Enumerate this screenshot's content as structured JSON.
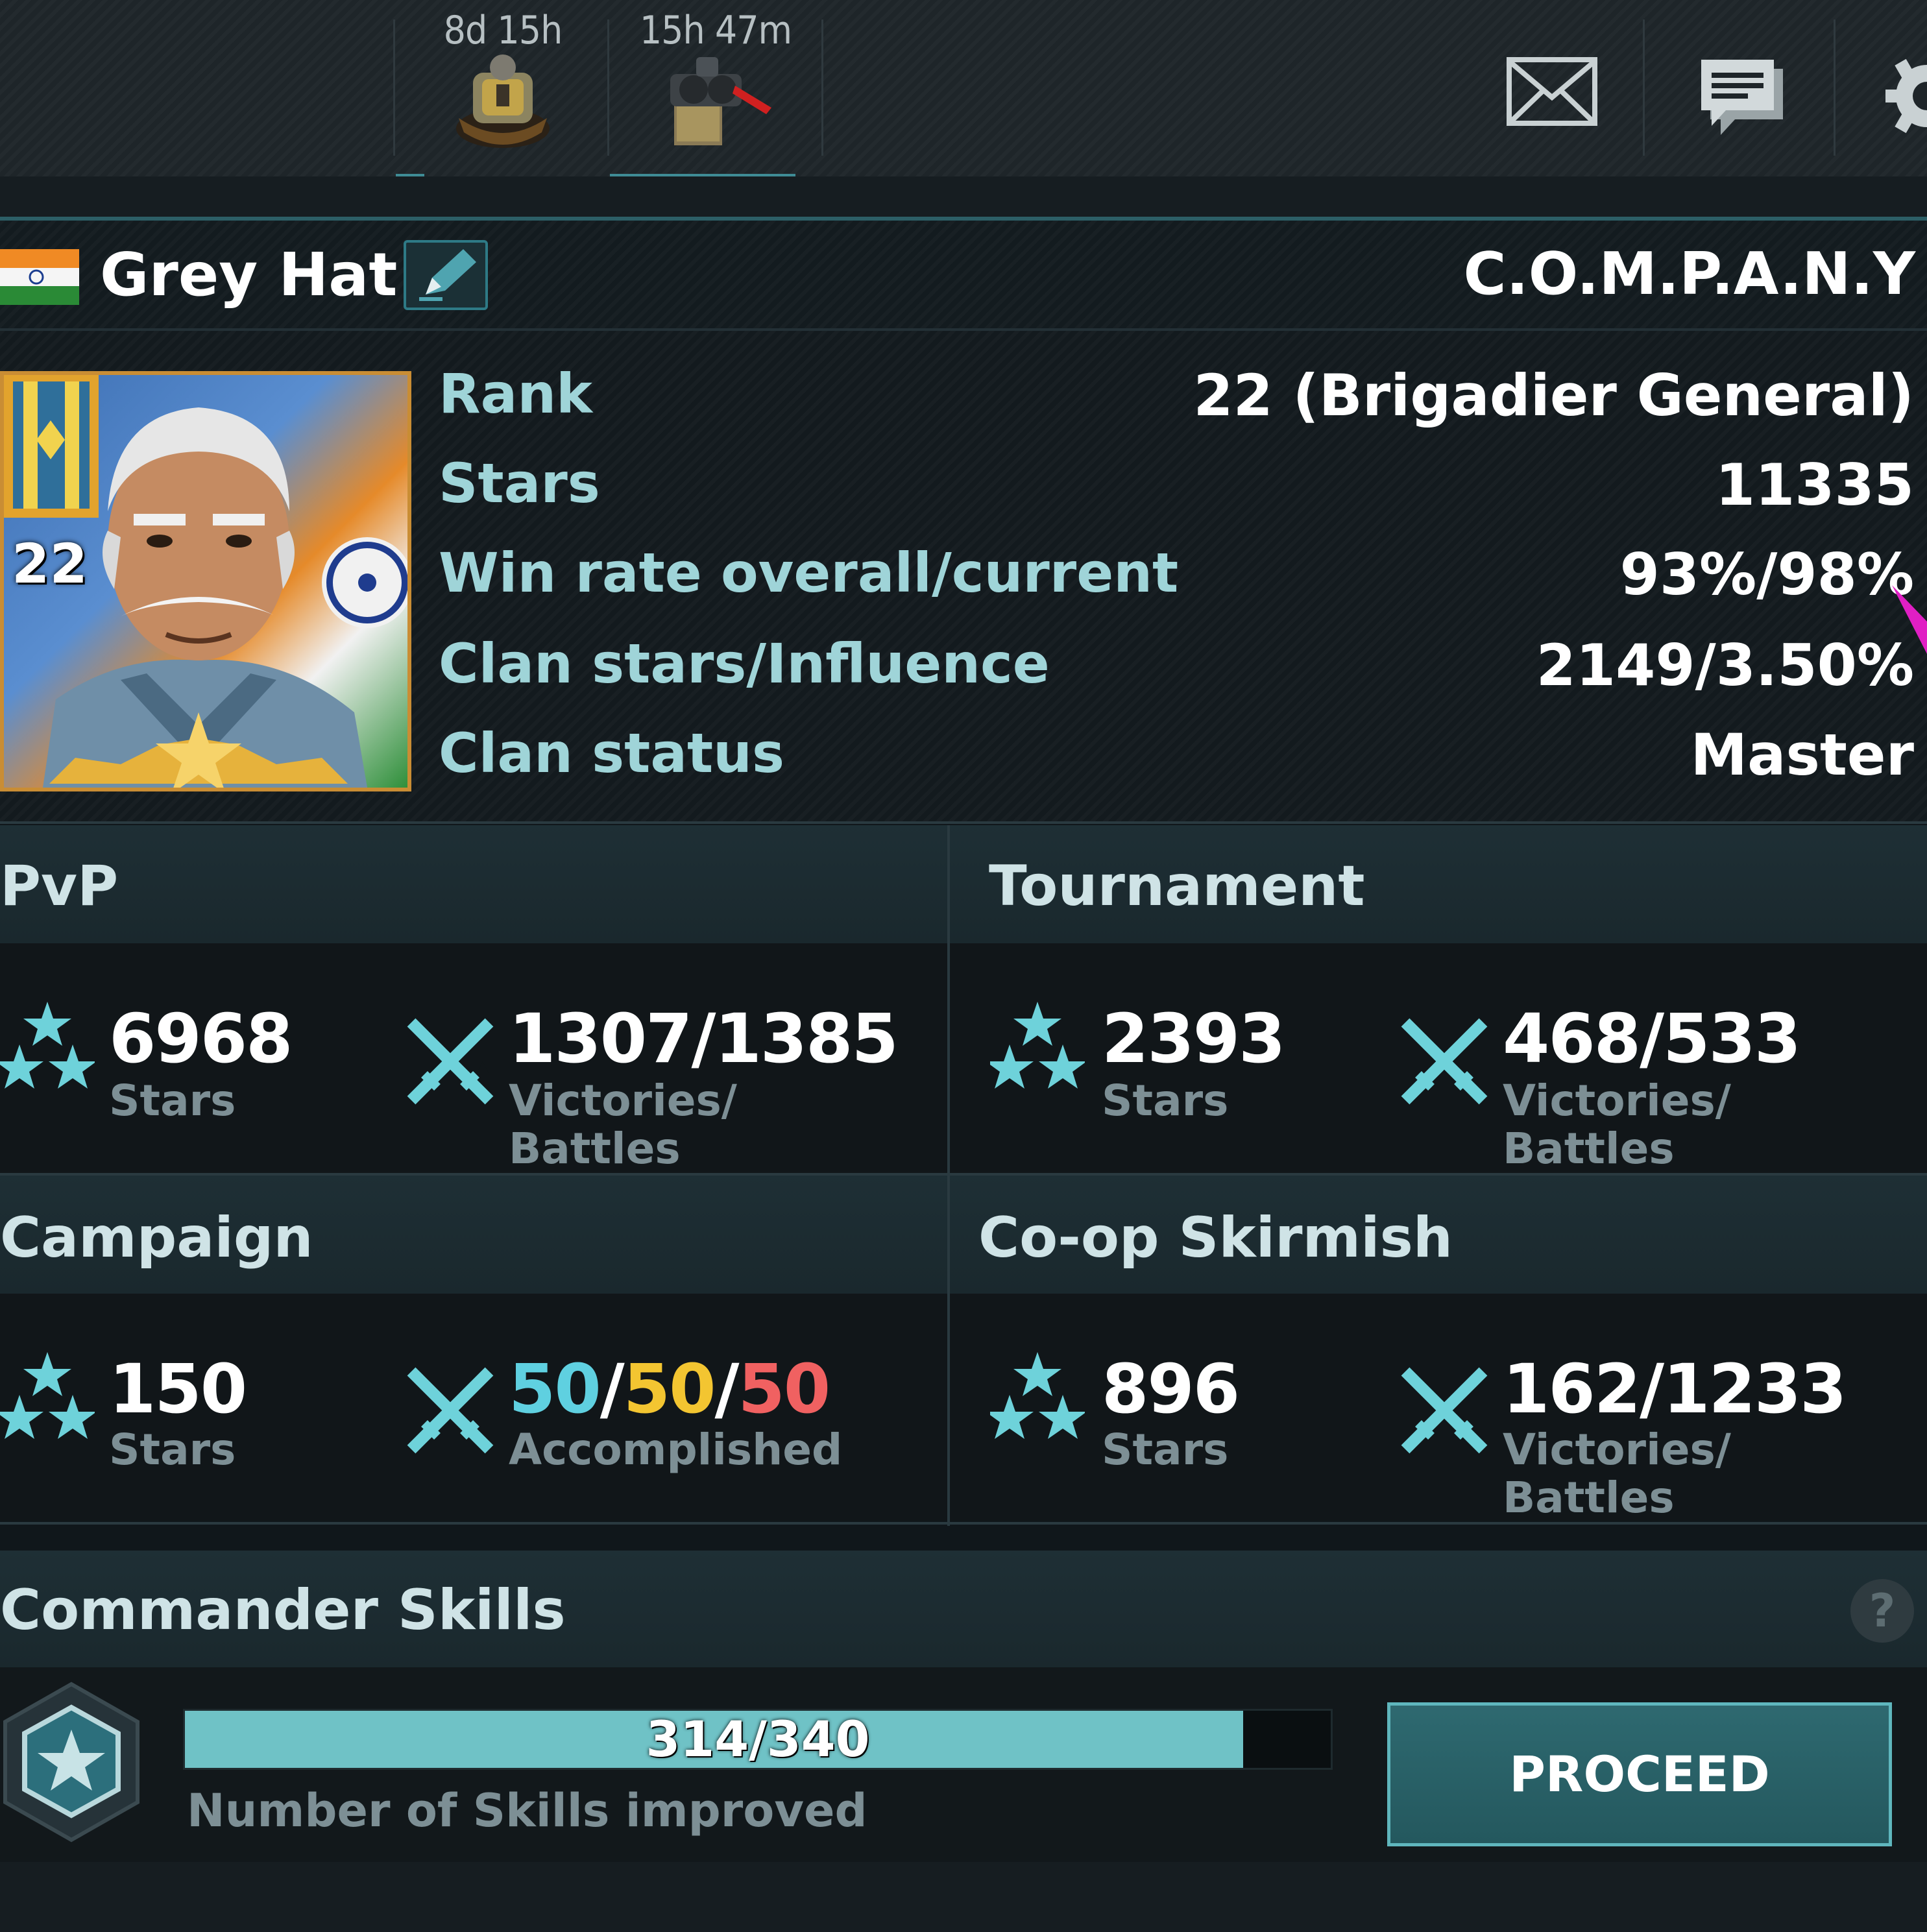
{
  "topbar": {
    "timers": [
      {
        "text": "8d 15h",
        "icon": "helmet-crate-icon"
      },
      {
        "text": "15h 47m",
        "icon": "weapon-crate-icon"
      }
    ],
    "icons": [
      "mail-icon",
      "chat-icon",
      "gear-icon"
    ]
  },
  "player": {
    "name": "Grey Hat",
    "flag": "india-flag-icon",
    "clan": "C.O.M.P.A.N.Y",
    "rank_badge": "22"
  },
  "stats": [
    {
      "label": "Rank",
      "value": "22 (Brigadier General)"
    },
    {
      "label": "Stars",
      "value": "11335"
    },
    {
      "label": "Win rate overall/current",
      "value": "93%/98%"
    },
    {
      "label": "Clan stars/Influence",
      "value": "2149/3.50%"
    },
    {
      "label": "Clan status",
      "value": "Master"
    }
  ],
  "modes": {
    "pvp": {
      "title": "PvP",
      "stars": "6968",
      "stars_label": "Stars",
      "record": "1307/1385",
      "record_label_1": "Victories/",
      "record_label_2": "Battles"
    },
    "tournament": {
      "title": "Tournament",
      "stars": "2393",
      "stars_label": "Stars",
      "record": "468/533",
      "record_label_1": "Victories/",
      "record_label_2": "Battles"
    },
    "campaign": {
      "title": "Campaign",
      "stars": "150",
      "stars_label": "Stars",
      "acc_1": "50",
      "acc_2": "50",
      "acc_3": "50",
      "sep": "/",
      "record_label_1": "Accomplished"
    },
    "coop": {
      "title": "Co-op Skirmish",
      "stars": "896",
      "stars_label": "Stars",
      "record": "162/1233",
      "record_label_1": "Victories/",
      "record_label_2": "Battles"
    }
  },
  "skills": {
    "title": "Commander Skills",
    "help": "?",
    "progress_text": "314/340",
    "progress_current": 314,
    "progress_total": 340,
    "caption": "Number of Skills improved",
    "button": "PROCEED"
  },
  "colors": {
    "accent_teal": "#3f8c95",
    "label_cyan": "#9fd4d8",
    "campaign_blue": "#5fd0e0",
    "campaign_yellow": "#f3c531",
    "campaign_red": "#f06161"
  }
}
